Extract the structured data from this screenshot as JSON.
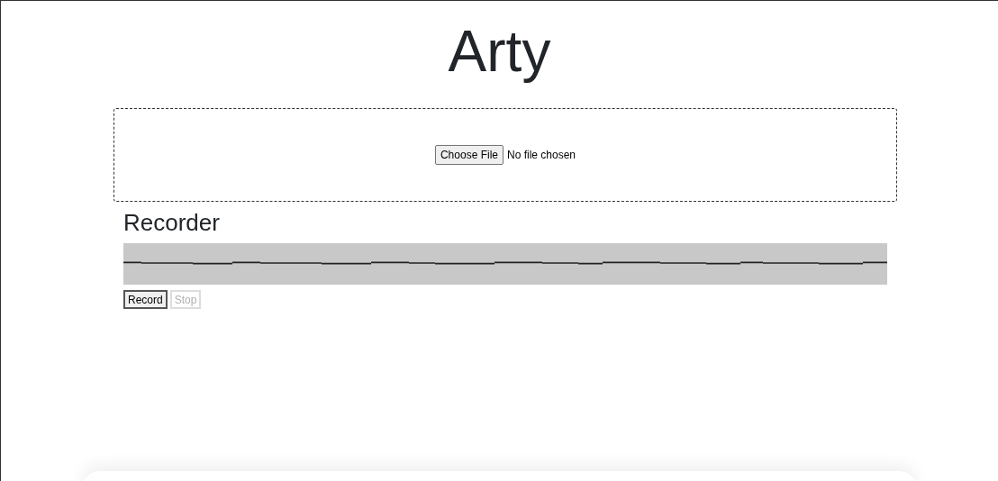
{
  "title": "Arty",
  "upload": {
    "button": "Choose File",
    "status": "No file chosen"
  },
  "recorder": {
    "heading": "Recorder",
    "buttons": [
      {
        "label": "Record",
        "disabled": false
      },
      {
        "label": "Stop",
        "disabled": true
      }
    ]
  }
}
